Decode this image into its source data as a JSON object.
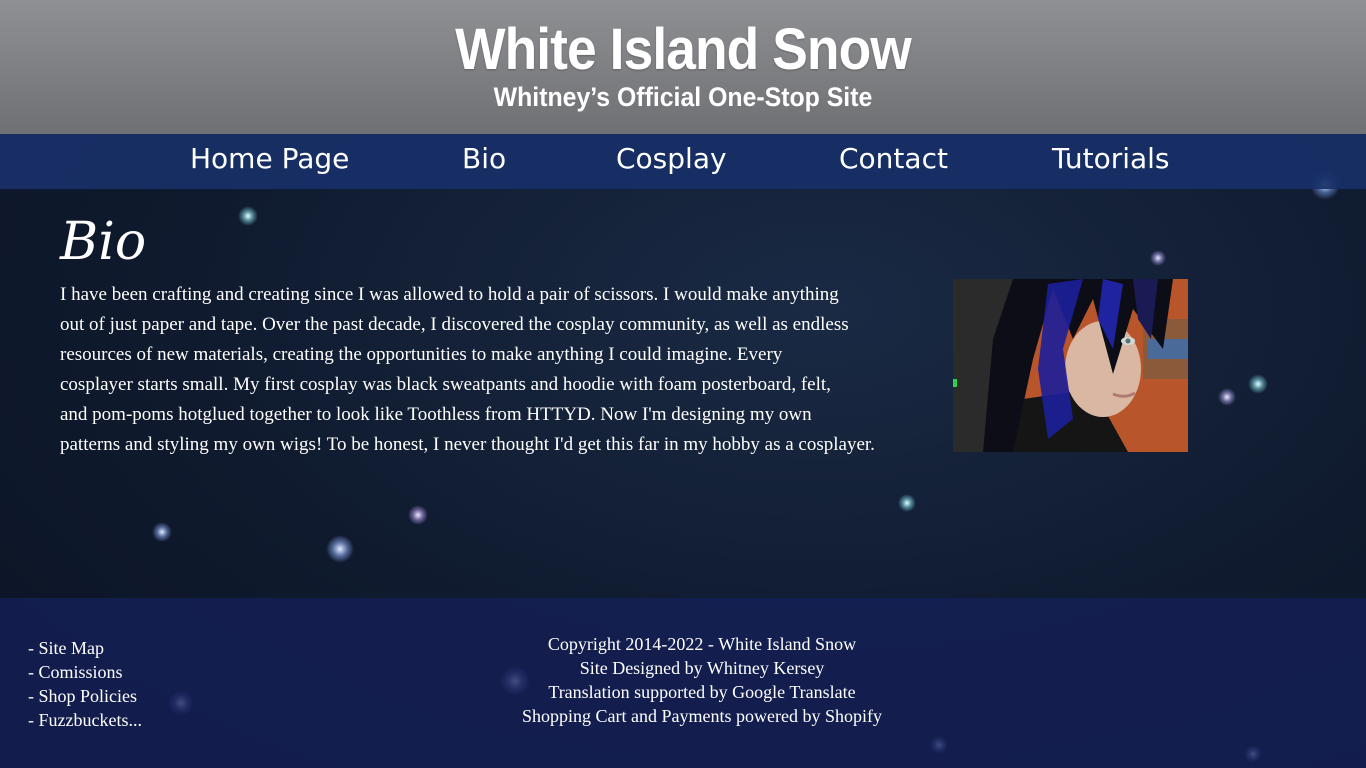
{
  "header": {
    "title": "White Island Snow",
    "subtitle": "Whitney’s Official One-Stop Site"
  },
  "nav": {
    "items": [
      {
        "label": "Home Page"
      },
      {
        "label": "Bio"
      },
      {
        "label": "Cosplay"
      },
      {
        "label": "Contact"
      },
      {
        "label": "Tutorials"
      }
    ]
  },
  "main": {
    "title": "Bio",
    "lines": [
      "I have been crafting and creating since I was allowed to hold a pair of scissors. I would make anything",
      "out of just paper and tape. Over the past decade, I discovered the cosplay community, as well as endless",
      "resources of new materials, creating the opportunities to make anything I could imagine. Every",
      "cosplayer starts small. My first cosplay was black sweatpants and hoodie with foam posterboard, felt,",
      "and pom-poms hotglued together to look like Toothless from HTTYD. Now I'm designing my own",
      "patterns and styling my own wigs! To be honest, I never thought I'd get this far in my hobby as a cosplayer."
    ]
  },
  "footer": {
    "links": [
      {
        "label": "- Site Map"
      },
      {
        "label": "- Comissions"
      },
      {
        "label": "- Shop Policies"
      },
      {
        "label": "- Fuzzbuckets..."
      }
    ],
    "credits": [
      "Copyright 2014-2022 - White Island Snow",
      "Site Designed by Whitney Kersey",
      "Translation supported by Google Translate",
      "Shopping Cart and Payments powered by Shopify"
    ]
  },
  "colors": {
    "header_bg": "#7c7d80",
    "nav_bg": "#183068",
    "page_bg": "#0f1a2e",
    "footer_bg": "#142058",
    "text": "#ffffff"
  }
}
